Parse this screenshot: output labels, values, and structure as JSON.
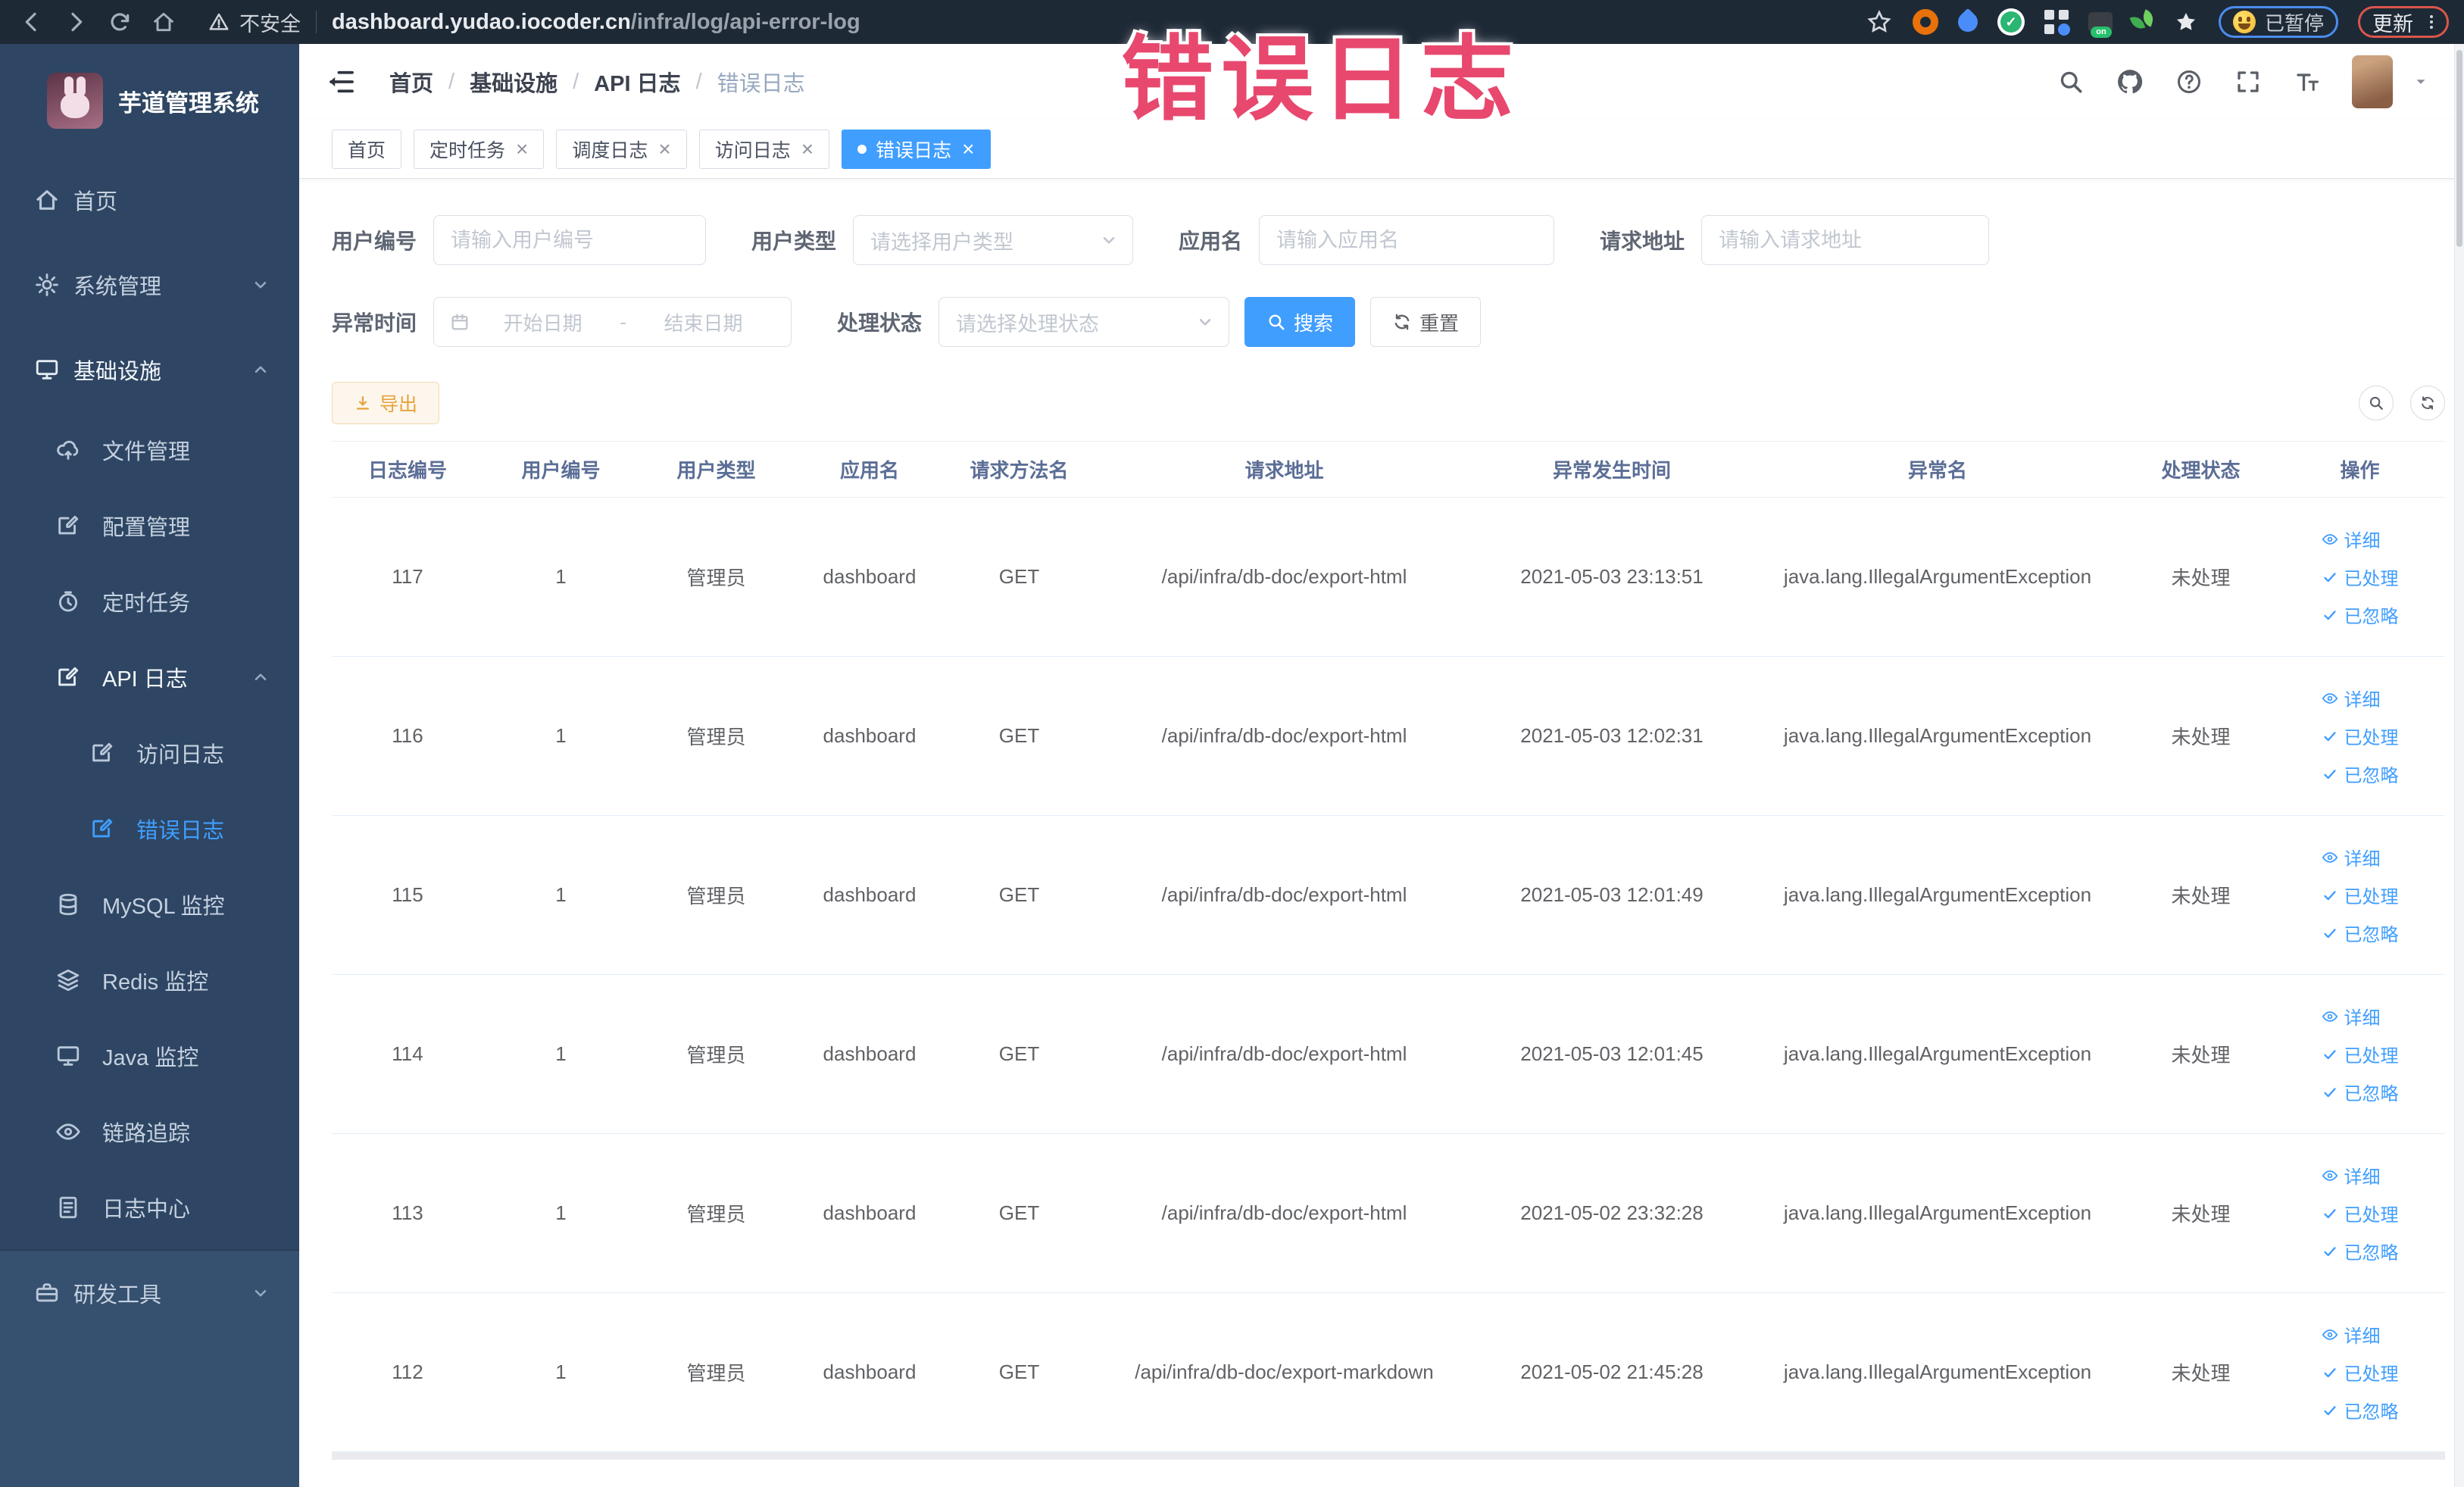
{
  "browser": {
    "security_label": "不安全",
    "url_domain": "dashboard.yudao.iocoder.cn",
    "url_path": "/infra/log/api-error-log",
    "paused_label": "已暂停",
    "update_label": "更新"
  },
  "overlay": {
    "text": "错误日志",
    "color": "#e8486e"
  },
  "sidebar": {
    "logo_title": "芋道管理系统",
    "items": [
      {
        "label": "首页",
        "icon": "home-icon",
        "level": 1
      },
      {
        "label": "系统管理",
        "icon": "gear-icon",
        "level": 1,
        "chevron": "down"
      },
      {
        "label": "基础设施",
        "icon": "infra-monitor-icon",
        "level": 1,
        "chevron": "up",
        "expanded": true
      },
      {
        "label": "文件管理",
        "icon": "cloud-upload-icon",
        "level": 2
      },
      {
        "label": "配置管理",
        "icon": "edit-doc-icon",
        "level": 2
      },
      {
        "label": "定时任务",
        "icon": "timer-icon",
        "level": 2
      },
      {
        "label": "API 日志",
        "icon": "edit-doc-icon",
        "level": 2,
        "chevron": "up",
        "expanded": true
      },
      {
        "label": "访问日志",
        "icon": "edit-doc-icon",
        "level": 3
      },
      {
        "label": "错误日志",
        "icon": "edit-doc-icon",
        "level": 3,
        "active": true
      },
      {
        "label": "MySQL 监控",
        "icon": "database-icon",
        "level": 2
      },
      {
        "label": "Redis 监控",
        "icon": "stack-icon",
        "level": 2
      },
      {
        "label": "Java 监控",
        "icon": "monitor-icon",
        "level": 2
      },
      {
        "label": "链路追踪",
        "icon": "eye-icon",
        "level": 2
      },
      {
        "label": "日志中心",
        "icon": "log-doc-icon",
        "level": 2
      },
      {
        "label": "研发工具",
        "icon": "briefcase-icon",
        "level": 1,
        "chevron": "down"
      }
    ]
  },
  "breadcrumb": {
    "separator": "/",
    "items": [
      "首页",
      "基础设施",
      "API 日志",
      "错误日志"
    ]
  },
  "tabs": [
    {
      "label": "首页",
      "closable": false,
      "active": false
    },
    {
      "label": "定时任务",
      "closable": true,
      "active": false
    },
    {
      "label": "调度日志",
      "closable": true,
      "active": false
    },
    {
      "label": "访问日志",
      "closable": true,
      "active": false
    },
    {
      "label": "错误日志",
      "closable": true,
      "active": true
    }
  ],
  "filters": {
    "user_id": {
      "label": "用户编号",
      "placeholder": "请输入用户编号"
    },
    "user_type": {
      "label": "用户类型",
      "placeholder": "请选择用户类型"
    },
    "app_name": {
      "label": "应用名",
      "placeholder": "请输入应用名"
    },
    "request_url": {
      "label": "请求地址",
      "placeholder": "请输入请求地址"
    },
    "exception_time": {
      "label": "异常时间",
      "start_placeholder": "开始日期",
      "separator": "-",
      "end_placeholder": "结束日期"
    },
    "process_status": {
      "label": "处理状态",
      "placeholder": "请选择处理状态"
    },
    "search_label": "搜索",
    "reset_label": "重置"
  },
  "toolbar": {
    "export_label": "导出"
  },
  "table": {
    "headers": [
      "日志编号",
      "用户编号",
      "用户类型",
      "应用名",
      "请求方法名",
      "请求地址",
      "异常发生时间",
      "异常名",
      "处理状态",
      "操作"
    ],
    "action_labels": {
      "detail": "详细",
      "processed": "已处理",
      "ignored": "已忽略"
    },
    "rows": [
      {
        "id": "117",
        "user_id": "1",
        "user_type": "管理员",
        "app": "dashboard",
        "method": "GET",
        "url": "/api/infra/db-doc/export-html",
        "time": "2021-05-03 23:13:51",
        "exception": "java.lang.IllegalArgumentException",
        "status": "未处理"
      },
      {
        "id": "116",
        "user_id": "1",
        "user_type": "管理员",
        "app": "dashboard",
        "method": "GET",
        "url": "/api/infra/db-doc/export-html",
        "time": "2021-05-03 12:02:31",
        "exception": "java.lang.IllegalArgumentException",
        "status": "未处理"
      },
      {
        "id": "115",
        "user_id": "1",
        "user_type": "管理员",
        "app": "dashboard",
        "method": "GET",
        "url": "/api/infra/db-doc/export-html",
        "time": "2021-05-03 12:01:49",
        "exception": "java.lang.IllegalArgumentException",
        "status": "未处理"
      },
      {
        "id": "114",
        "user_id": "1",
        "user_type": "管理员",
        "app": "dashboard",
        "method": "GET",
        "url": "/api/infra/db-doc/export-html",
        "time": "2021-05-03 12:01:45",
        "exception": "java.lang.IllegalArgumentException",
        "status": "未处理"
      },
      {
        "id": "113",
        "user_id": "1",
        "user_type": "管理员",
        "app": "dashboard",
        "method": "GET",
        "url": "/api/infra/db-doc/export-html",
        "time": "2021-05-02 23:32:28",
        "exception": "java.lang.IllegalArgumentException",
        "status": "未处理"
      },
      {
        "id": "112",
        "user_id": "1",
        "user_type": "管理员",
        "app": "dashboard",
        "method": "GET",
        "url": "/api/infra/db-doc/export-markdown",
        "time": "2021-05-02 21:45:28",
        "exception": "java.lang.IllegalArgumentException",
        "status": "未处理"
      }
    ]
  },
  "colors": {
    "accent": "#409eff",
    "warning": "#e6a23c",
    "overlay_pink": "#e8486e",
    "sidebar_bg": "#2e4663",
    "browser_bar": "#1e2936"
  }
}
